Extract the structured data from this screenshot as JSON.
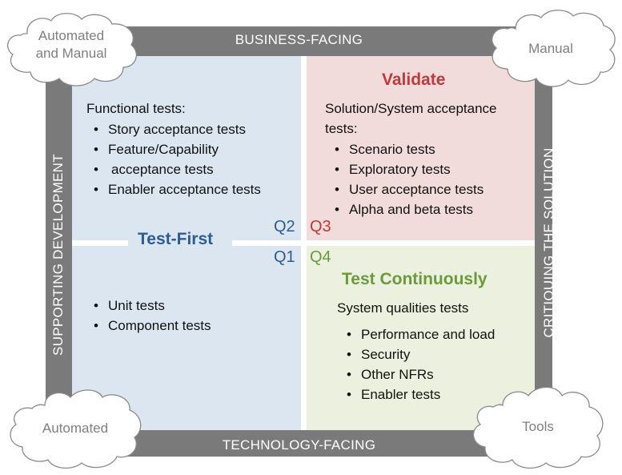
{
  "bands": {
    "top": "BUSINESS-FACING",
    "bottom": "TECHNOLOGY-FACING",
    "left": "SUPPORTING DEVELOPMENT",
    "right": "CRITIQUING THE SOLUTION"
  },
  "clouds": {
    "top_left": [
      "Automated",
      "and Manual"
    ],
    "top_right": "Manual",
    "bottom_left": "Automated",
    "bottom_right": "Tools"
  },
  "colors": {
    "frame": "#7a7a7a",
    "left_quadrants": "#dce6f1",
    "q3_fill": "#f2dcdb",
    "q4_fill": "#ebf1de",
    "blue_text": "#2f5b93",
    "red_text": "#c0393b",
    "green_text": "#6a9a3a"
  },
  "quadrants": {
    "q2": {
      "label": "Q2",
      "heading": "Functional tests:",
      "items": [
        "Story acceptance tests",
        "Feature/Capability",
        "Enabler acceptance tests"
      ],
      "item_continuation": "acceptance tests"
    },
    "q3": {
      "label": "Q3",
      "title": "Validate",
      "heading_line1": "Solution/System acceptance",
      "heading_line2": "tests:",
      "items": [
        "Scenario tests",
        "Exploratory tests",
        "User acceptance tests",
        "Alpha and beta tests"
      ]
    },
    "q1": {
      "label": "Q1",
      "items": [
        "Unit tests",
        "Component tests"
      ]
    },
    "q4": {
      "label": "Q4",
      "title": "Test Continuously",
      "heading": "System qualities tests",
      "items": [
        "Performance and load",
        "Security",
        "Other NFRs",
        "Enabler tests"
      ]
    }
  },
  "left_title": "Test-First"
}
